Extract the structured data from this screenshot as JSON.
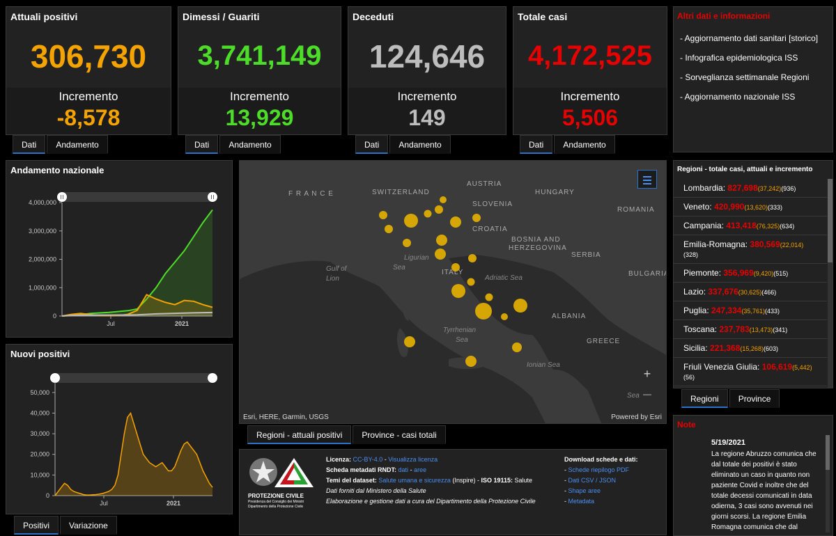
{
  "stats": [
    {
      "title": "Attuali positivi",
      "value": "306,730",
      "inc_label": "Incremento",
      "inc_value": "-8,578",
      "color": "#f5a300",
      "tabs": [
        "Dati",
        "Andamento"
      ]
    },
    {
      "title": "Dimessi / Guariti",
      "value": "3,741,149",
      "inc_label": "Incremento",
      "inc_value": "13,929",
      "color": "#4ddc29",
      "tabs": [
        "Dati",
        "Andamento"
      ]
    },
    {
      "title": "Deceduti",
      "value": "124,646",
      "inc_label": "Incremento",
      "inc_value": "149",
      "color": "#bdbdbd",
      "tabs": [
        "Dati",
        "Andamento"
      ]
    },
    {
      "title": "Totale casi",
      "value": "4,172,525",
      "inc_label": "Incremento",
      "inc_value": "5,506",
      "color": "#e60000",
      "tabs": [
        "Dati",
        "Andamento"
      ]
    }
  ],
  "links": {
    "title": "Altri dati e informazioni",
    "items": [
      "- Aggiornamento dati sanitari [storico]",
      "- Infografica epidemiologica ISS",
      "- Sorveglianza settimanale Regioni",
      "- Aggiornamento nazionale ISS"
    ]
  },
  "andamento": {
    "title": "Andamento nazionale",
    "chart_data": {
      "type": "line",
      "x_ticks": [
        "Jul",
        "2021"
      ],
      "y_ticks": [
        "4,000,000",
        "3,000,000",
        "2,000,000",
        "1,000,000",
        "0"
      ],
      "ylim": [
        0,
        4000000
      ],
      "series": [
        {
          "values": [
            0,
            30000,
            50000,
            90000,
            110000,
            130000,
            160000,
            190000,
            250000,
            600000,
            1000000,
            1500000,
            1900000,
            2300000,
            2800000,
            3300000,
            3741149
          ],
          "color": "#4ddc29"
        },
        {
          "values": [
            0,
            60000,
            90000,
            50000,
            20000,
            15000,
            20000,
            60000,
            200000,
            750000,
            600000,
            480000,
            400000,
            550000,
            520000,
            400000,
            306730
          ],
          "color": "#f5a300"
        },
        {
          "values": [
            0,
            20000,
            33000,
            35000,
            35000,
            35000,
            36000,
            38000,
            42000,
            60000,
            75000,
            85000,
            95000,
            105000,
            112000,
            120000,
            124646
          ],
          "color": "#bdbdbd"
        }
      ]
    }
  },
  "nuovi": {
    "title": "Nuovi positivi",
    "chart_data": {
      "type": "area",
      "x_ticks": [
        "Jul",
        "2021"
      ],
      "y_ticks": [
        "50,000",
        "40,000",
        "30,000",
        "20,000",
        "10,000",
        "0"
      ],
      "ylim": [
        0,
        55000
      ],
      "values": [
        0,
        2000,
        4000,
        6000,
        5000,
        3000,
        2000,
        1500,
        1000,
        500,
        300,
        300,
        400,
        500,
        700,
        1000,
        1500,
        2000,
        3000,
        5000,
        10000,
        20000,
        30000,
        38000,
        40000,
        35000,
        30000,
        25000,
        20000,
        18000,
        16000,
        15000,
        14000,
        15000,
        16000,
        14000,
        12000,
        12000,
        14000,
        18000,
        22000,
        25000,
        26000,
        24000,
        22000,
        20000,
        16000,
        12000,
        9000,
        6000,
        4000
      ],
      "color": "#f5a300"
    },
    "tabs": [
      "Positivi",
      "Variazione"
    ]
  },
  "map": {
    "attribution": "Esri, HERE, Garmin, USGS",
    "powered": "Powered by Esri",
    "countries": [
      "F R A N C E",
      "SWITZERLAND",
      "AUSTRIA",
      "HUNGARY",
      "SLOVENIA",
      "CROATIA",
      "BOSNIA AND",
      "HERZEGOVINA",
      "ROMANIA",
      "SERBIA",
      "BULGARIA",
      "ITALY",
      "ALBANIA",
      "GREECE"
    ],
    "seas": [
      "Ligurian",
      "Sea",
      "Gulf of",
      "Lion",
      "Adriatic Sea",
      "Tyrrhenian",
      "Sea",
      "Ionian Sea",
      "Sea"
    ],
    "tabs": [
      "Regioni - attuali positivi",
      "Province - casi totali"
    ],
    "zoom_in": "+",
    "zoom_out": "—"
  },
  "regions": {
    "title": "Regioni - totale casi, attuali e incremento",
    "rows": [
      {
        "name": "Lombardia:",
        "tot": "827,698",
        "act": "(37,242)",
        "inc": "(936)"
      },
      {
        "name": "Veneto:",
        "tot": "420,990",
        "act": "(13,620)",
        "inc": "(333)"
      },
      {
        "name": "Campania:",
        "tot": "413,418",
        "act": "(76,325)",
        "inc": "(634)"
      },
      {
        "name": "Emilia-Romagna:",
        "tot": "380,569",
        "act": "(22,014)",
        "inc": "(328)"
      },
      {
        "name": "Piemonte:",
        "tot": "356,969",
        "act": "(9,420)",
        "inc": "(515)"
      },
      {
        "name": "Lazio:",
        "tot": "337,676",
        "act": "(30,625)",
        "inc": "(466)"
      },
      {
        "name": "Puglia:",
        "tot": "247,334",
        "act": "(35,761)",
        "inc": "(433)"
      },
      {
        "name": "Toscana:",
        "tot": "237,783",
        "act": "(13,473)",
        "inc": "(341)"
      },
      {
        "name": "Sicilia:",
        "tot": "221,368",
        "act": "(15,268)",
        "inc": "(603)"
      },
      {
        "name": "Friuli Venezia Giulia:",
        "tot": "106,619",
        "act": "(5,442)",
        "inc": "(56)"
      }
    ],
    "tabs": [
      "Regioni",
      "Province"
    ]
  },
  "info": {
    "logo_caption": "PROTEZIONE CIVILE",
    "logo_sub1": "Presidenza del Consiglio dei Ministri",
    "logo_sub2": "Dipartimento della Protezione Civile",
    "licenza_label": "Licenza:",
    "licenza_link1": "CC-BY-4.0",
    "licenza_link2": "Visualizza licenza",
    "rndt_label": "Scheda metadati RNDT:",
    "rndt_link1": "dati",
    "rndt_link2": "aree",
    "temi_label": "Temi del dataset:",
    "temi_link": "Salute umana e sicurezza",
    "temi_rest": "(Inspire) -",
    "iso_label": "ISO 19115:",
    "iso_value": "Salute",
    "fonte": "Dati forniti dal Ministero della Salute",
    "elab": "Elaborazione e gestione dati a cura del Dipartimento della Protezione Civile",
    "download_title": "Download schede e dati:",
    "downloads": [
      "Schede riepilogo PDF",
      "Dati CSV / JSON",
      "Shape aree",
      "Metadata"
    ]
  },
  "note": {
    "title": "Note",
    "date": "5/19/2021",
    "text": "La regione Abruzzo comunica che dal totale dei positivi è stato eliminato un caso in quanto non paziente Covid e inoltre che del totale decessi comunicati in data odierna, 3 casi sono avvenuti nei giorni scorsi. La regione Emilia Romagna comunica che dal"
  },
  "colors": {
    "accent": "#2b73c7",
    "red": "#e60000",
    "orange": "#f5a300",
    "green": "#4ddc29",
    "grey": "#bdbdbd"
  }
}
